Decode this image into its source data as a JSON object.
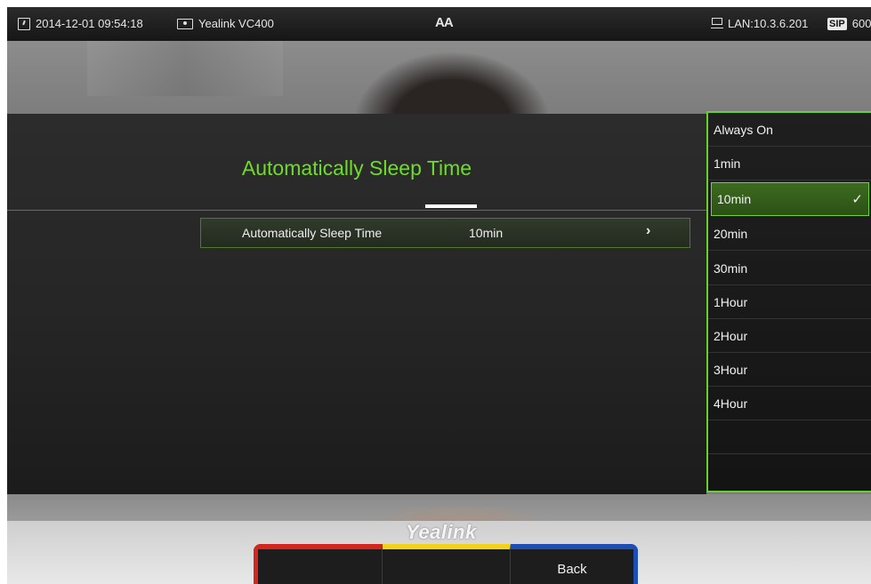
{
  "status_bar": {
    "datetime": "2014-12-01 09:54:18",
    "device": "Yealink VC400",
    "font_toggle": "AA",
    "network": "LAN:10.3.6.201",
    "sip_badge": "SIP",
    "account": "600"
  },
  "panel": {
    "title": "Automatically Sleep Time",
    "row": {
      "label": "Automatically Sleep Time",
      "value": "10min",
      "arrow": "›"
    }
  },
  "dropdown": {
    "options": [
      "Always On",
      "1min",
      "10min",
      "20min",
      "30min",
      "1Hour",
      "2Hour",
      "3Hour",
      "4Hour"
    ],
    "selected": "10min",
    "check_glyph": "✓"
  },
  "logo": "Yealink",
  "softkeys": [
    {
      "color": "red",
      "label": ""
    },
    {
      "color": "yellow",
      "label": ""
    },
    {
      "color": "blue",
      "label": "Back"
    }
  ],
  "colors": {
    "accent_green": "#66d12d",
    "red_key": "#d4261f",
    "yellow_key": "#f4d11a",
    "blue_key": "#1d4eb4"
  },
  "icons": [
    "clock-icon",
    "device-icon",
    "lan-icon",
    "chevron-right-icon",
    "checkmark-icon"
  ]
}
